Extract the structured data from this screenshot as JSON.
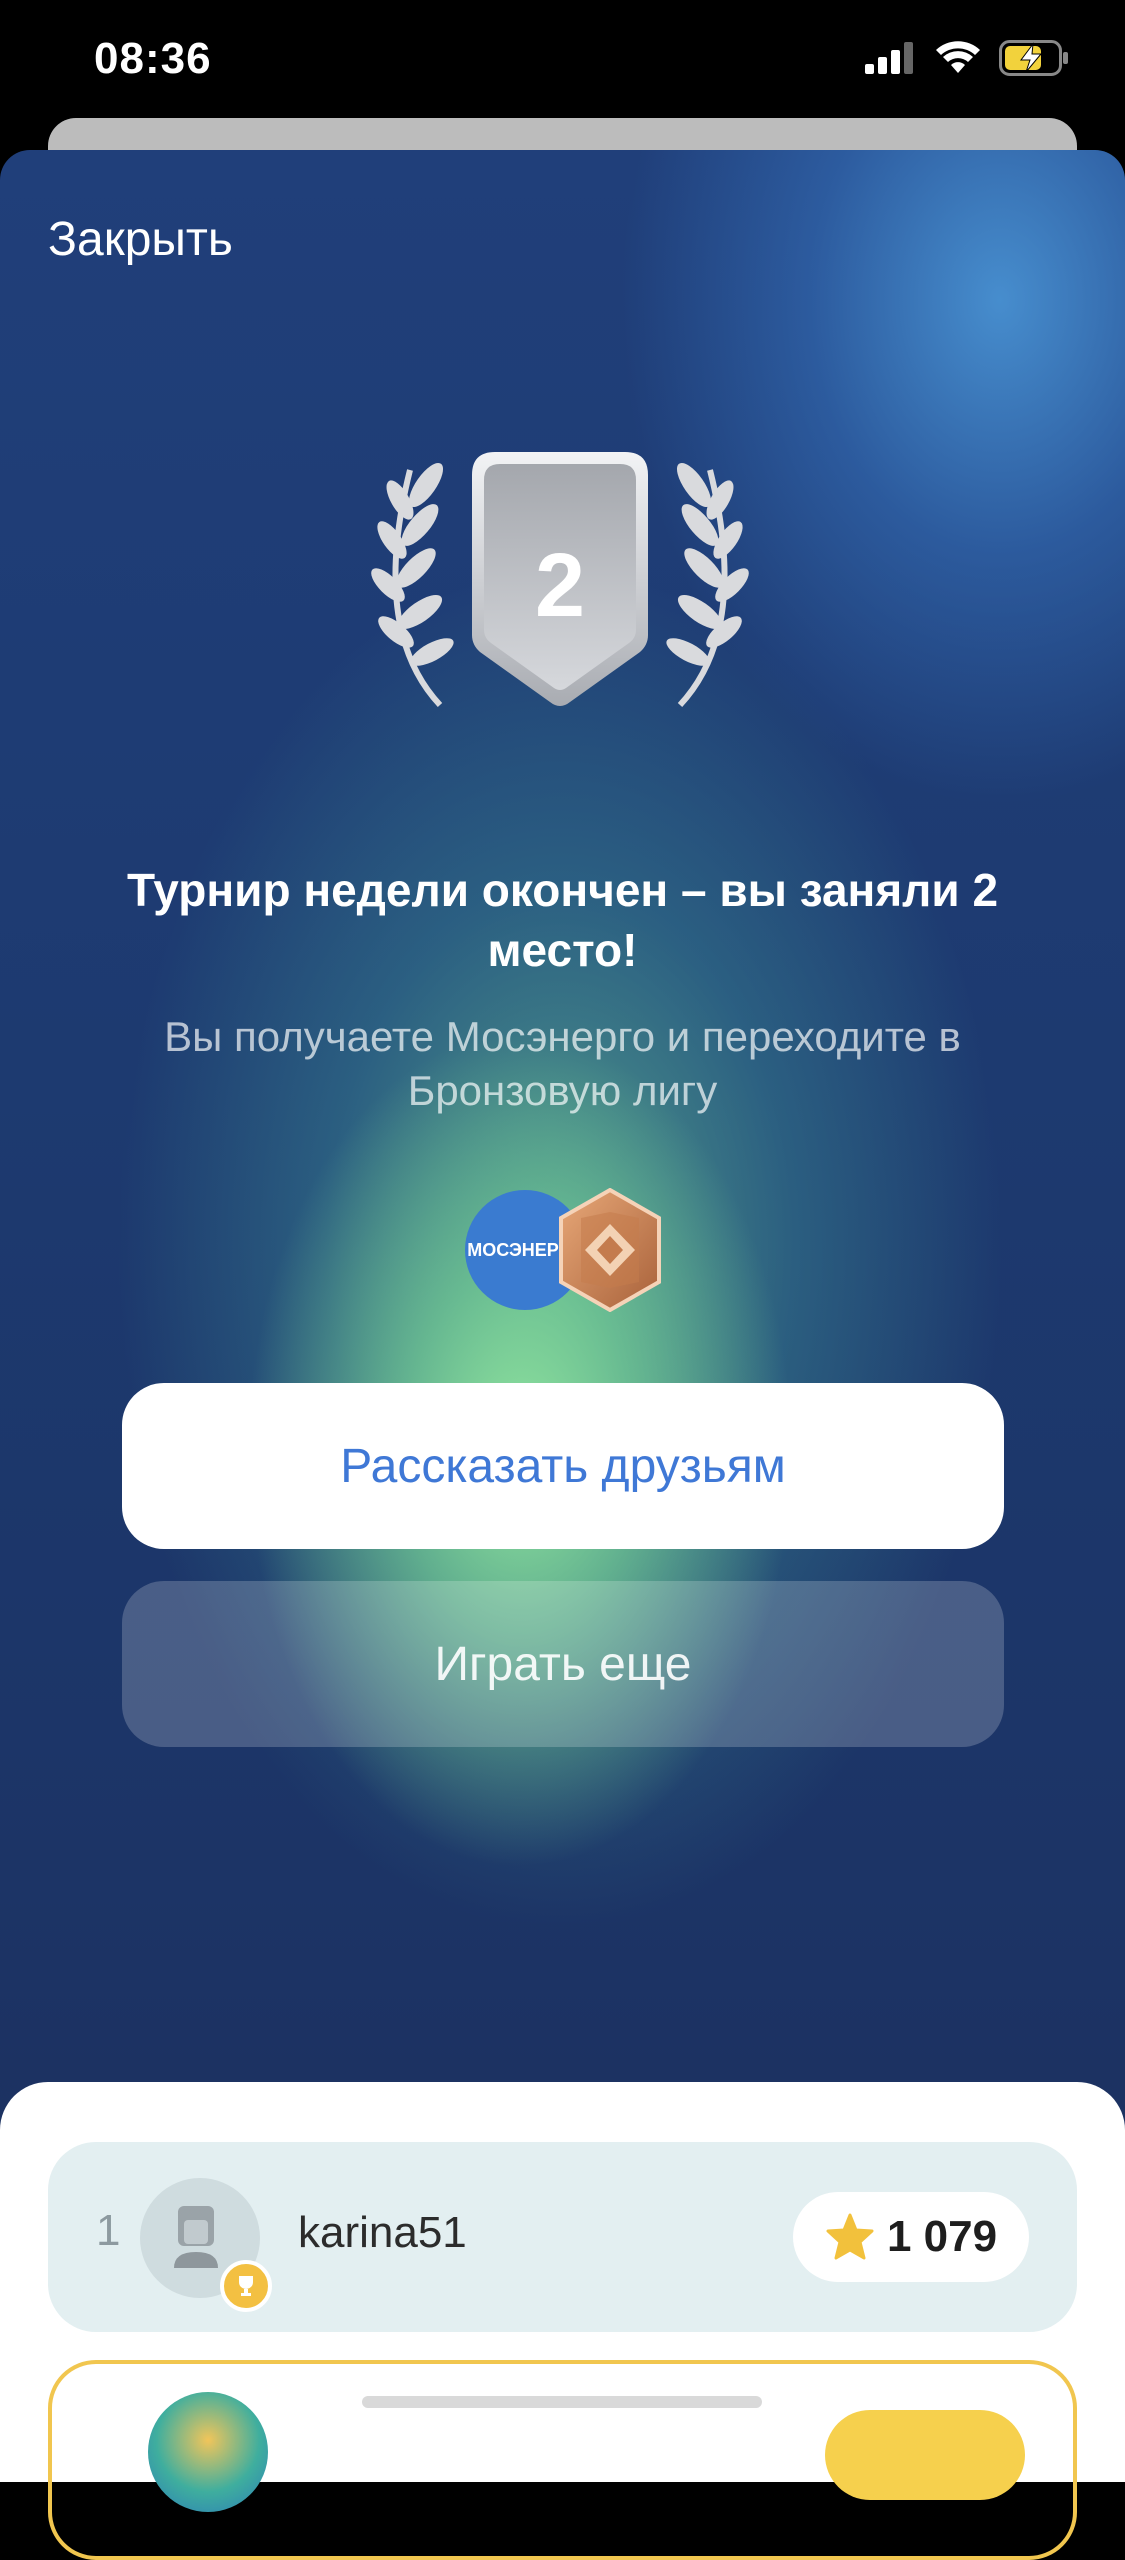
{
  "status_bar": {
    "time": "08:36"
  },
  "sheet": {
    "close_label": "Закрыть"
  },
  "result": {
    "place": "2",
    "title": "Турнир недели окончен – вы заняли 2 место!",
    "subtitle": "Вы получаете Мосэнерго и переходите в Бронзовую лигу"
  },
  "rewards": {
    "company_logo_text": "МОСЭНЕРГО"
  },
  "actions": {
    "share_label": "Рассказать друзьям",
    "play_again_label": "Играть еще"
  },
  "leaderboard": {
    "rows": [
      {
        "rank": "1",
        "username": "karina51",
        "score": "1 079"
      }
    ]
  },
  "colors": {
    "accent_blue": "#3f78d6",
    "gold": "#f3c042",
    "bronze": "#c47b4d"
  }
}
